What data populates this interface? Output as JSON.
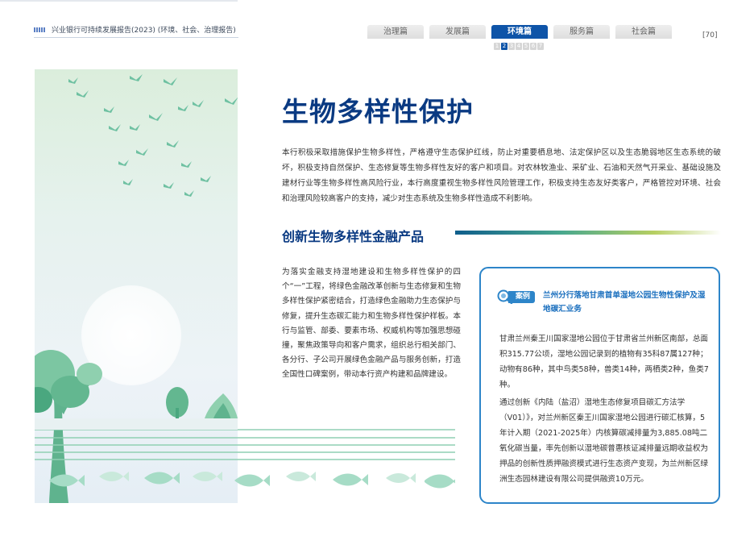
{
  "header": {
    "title": "兴业银行可持续发展报告(2023) (环境、社会、治理报告)",
    "page_number": "[70]"
  },
  "nav": {
    "tabs": [
      {
        "label": "治理篇",
        "active": false
      },
      {
        "label": "发展篇",
        "active": false
      },
      {
        "label": "环境篇",
        "active": true
      },
      {
        "label": "服务篇",
        "active": false
      },
      {
        "label": "社会篇",
        "active": false
      }
    ],
    "subpages": [
      "1",
      "2",
      "3",
      "4",
      "5",
      "6",
      "7"
    ],
    "active_subpage": "2"
  },
  "main": {
    "title": "生物多样性保护",
    "intro": "本行积极采取措施保护生物多样性，严格遵守生态保护红线，防止对重要栖息地、法定保护区以及生态脆弱地区生态系统的破坏，积极支持自然保护、生态修复等生物多样性友好的客户和项目。对农林牧渔业、采矿业、石油和天然气开采业、基础设施及建材行业等生物多样性高风险行业，本行高度重视生物多样性风险管理工作，积极支持生态友好类客户，严格管控对环境、社会和治理风险较高客户的支持，减少对生态系统及生物多样性造成不利影响。",
    "section_heading": "创新生物多样性金融产品",
    "section_body": "为落实金融支持湿地建设和生物多样性保护的四个“一”工程，将绿色金融改革创新与生态修复和生物多样性保护紧密结合，打造绿色金融助力生态保护与修复，提升生态碳汇能力和生物多样性保护样板。本行与监管、部委、要素市场、权威机构等加强思想碰撞，聚焦政策导向和客户需求，组织总行相关部门、各分行、子公司开展绿色金融产品与服务创新，打造全国性口碑案例，带动本行资产构建和品牌建设。"
  },
  "case": {
    "badge": "案例",
    "title": "兰州分行落地甘肃首单湿地公园生物性保护及湿地碳汇业务",
    "p1": "甘肃兰州秦王川国家湿地公园位于甘肃省兰州新区南部，总面积315.77公顷，湿地公园记录到的植物有35科87属127种；动物有86种，其中鸟类58种，兽类14种，两栖类2种，鱼类7种。",
    "p2": "通过创新《内陆（盐沼）湿地生态修复项目碳汇方法学（V01）》，对兰州新区秦王川国家湿地公园进行碳汇核算，5年计入期（2021-2025年）内核算碳减排量为3,885.08吨二氧化碳当量，率先创新以湿地碳普惠核证减排量远期收益权为押品的创新性质押融资模式进行生态资产变现，为兰州新区绿洲生态园林建设有限公司提供融资10万元。"
  },
  "colors": {
    "brand_blue": "#0a3a82",
    "tab_active": "#0e54a8",
    "case_border": "#2d85c9",
    "case_title": "#1a6fbe"
  }
}
